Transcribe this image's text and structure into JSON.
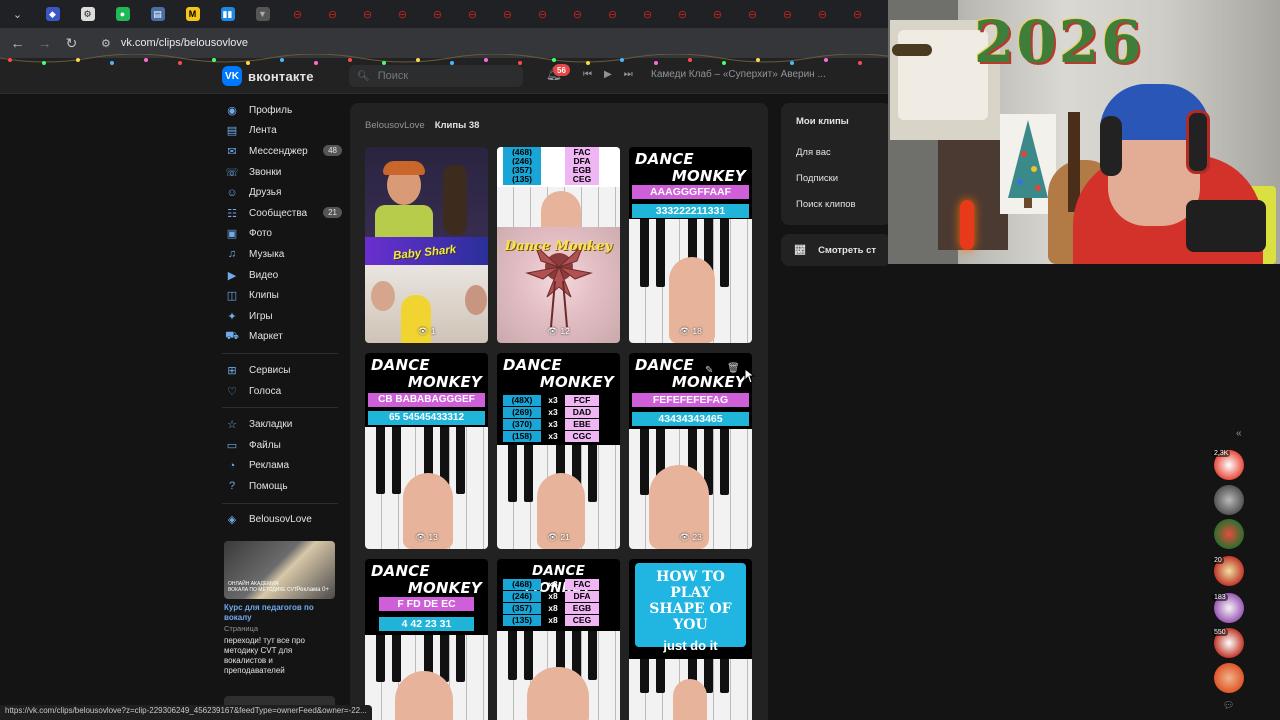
{
  "browser": {
    "url": "vk.com/clips/belousovlove",
    "status_url": "https://vk.com/clips/belousovlove?z=clip-229306249_456239167&feedType=ownerFeed&owner=-22..."
  },
  "vk_header": {
    "logo_text": "вконтакте",
    "search_placeholder": "Поиск",
    "notifications_count": "56",
    "now_playing": "Камеди Клаб – «Суперхит» Аверин ..."
  },
  "sidebar": {
    "items": [
      {
        "label": "Профиль",
        "icon": "profile-icon"
      },
      {
        "label": "Лента",
        "icon": "feed-icon"
      },
      {
        "label": "Мессенджер",
        "icon": "messenger-icon",
        "badge": "48"
      },
      {
        "label": "Звонки",
        "icon": "phone-icon"
      },
      {
        "label": "Друзья",
        "icon": "friends-icon"
      },
      {
        "label": "Сообщества",
        "icon": "communities-icon",
        "badge": "21"
      },
      {
        "label": "Фото",
        "icon": "photo-icon"
      },
      {
        "label": "Музыка",
        "icon": "music-icon"
      },
      {
        "label": "Видео",
        "icon": "video-icon"
      },
      {
        "label": "Клипы",
        "icon": "clips-icon"
      },
      {
        "label": "Игры",
        "icon": "games-icon"
      },
      {
        "label": "Маркет",
        "icon": "market-icon"
      }
    ],
    "items2": [
      {
        "label": "Сервисы",
        "icon": "services-icon"
      },
      {
        "label": "Голоса",
        "icon": "votes-icon"
      }
    ],
    "items3": [
      {
        "label": "Закладки",
        "icon": "bookmark-icon"
      },
      {
        "label": "Файлы",
        "icon": "files-icon"
      },
      {
        "label": "Реклама",
        "icon": "ads-icon"
      },
      {
        "label": "Помощь",
        "icon": "help-icon"
      }
    ],
    "group": {
      "label": "BelousovLove",
      "icon": "group-icon"
    }
  },
  "ad": {
    "image_caption": "ОНЛАЙН АКАДЕМИЯ ВОКАЛА ПО МЕТОДИКЕ CVT",
    "image_label": "Реклама 0+",
    "title": "Курс для педагогов по вокалу",
    "subtitle": "Страница",
    "text": "переходи! тут все про методику CVT для вокалистов и преподавателей"
  },
  "breadcrumb": {
    "owner": "BelousovLove",
    "current": "Клипы 38"
  },
  "clips": [
    {
      "views": "1",
      "caption": "Baby Shark"
    },
    {
      "views": "12",
      "caption": "Dance Monkey",
      "chords": [
        [
          "(468)",
          "x8",
          "FAC"
        ],
        [
          "(246)",
          "x8",
          "DFA"
        ],
        [
          "(357)",
          "x8",
          "EGB"
        ],
        [
          "(135)",
          "x8",
          "CEG"
        ]
      ]
    },
    {
      "views": "18",
      "title1": "DANCE",
      "title2": "MONKEY",
      "notes": "AAAGGGFFAAF",
      "numbers": "333222211331"
    },
    {
      "views": "13",
      "title1": "DANCE",
      "title2": "MONKEY",
      "notes": "CB BABABAGGGEF",
      "numbers": "65 54545433312"
    },
    {
      "views": "21",
      "title1": "DANCE",
      "title2": "MONKEY",
      "chords": [
        [
          "(48X)",
          "x3",
          "FCF"
        ],
        [
          "(269)",
          "x3",
          "DAD"
        ],
        [
          "(370)",
          "x3",
          "EBE"
        ],
        [
          "(158)",
          "x3",
          "CGC"
        ]
      ]
    },
    {
      "views": "23",
      "title1": "DANCE",
      "title2": "MONKEY",
      "notes": "FEFEFEFEFAG",
      "numbers": "43434343465"
    },
    {
      "title1": "DANCE",
      "title2": "MONKEY",
      "notes": "F FD DE EC",
      "numbers": "4 42 23 31"
    },
    {
      "title1": "DANCE MONKEY",
      "chords": [
        [
          "(468)",
          "x8",
          "FAC"
        ],
        [
          "(246)",
          "x8",
          "DFA"
        ],
        [
          "(357)",
          "x8",
          "EGB"
        ],
        [
          "(135)",
          "x8",
          "CEG"
        ]
      ]
    },
    {
      "line1": "HOW TO PLAY",
      "line2": "SHAPE OF YOU",
      "line3": "just do it"
    }
  ],
  "right_menu": {
    "my_clips": "Мои клипы",
    "for_you": "Для вас",
    "subscriptions": "Подписки",
    "search_clips": "Поиск клипов",
    "watch_stats": "Смотреть ст"
  },
  "webcam_year": "2026",
  "stream_counts": [
    "2,3K",
    "20",
    "183",
    "550"
  ],
  "colors": {
    "accent": "#0077ff",
    "link": "#71aaeb",
    "pink": "#cf5fd8",
    "cyan": "#20b4d8"
  }
}
